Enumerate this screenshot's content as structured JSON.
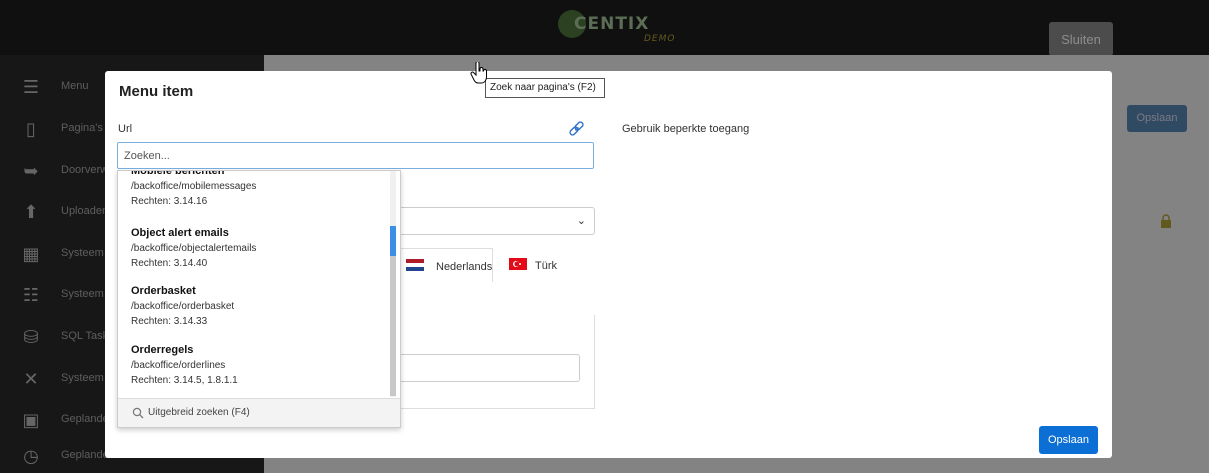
{
  "app": {
    "logo_text": "CENTIX",
    "logo_sub": "DEMO",
    "close_label": "Sluiten"
  },
  "sidebar": {
    "items": [
      {
        "icon": "menu-icon",
        "label": "Menu"
      },
      {
        "icon": "page-icon",
        "label": "Pagina's"
      },
      {
        "icon": "redirect-icon",
        "label": "Doorverw"
      },
      {
        "icon": "upload-icon",
        "label": "Uploaden"
      },
      {
        "icon": "table-icon",
        "label": "Systeem"
      },
      {
        "icon": "sliders-icon",
        "label": "Systeem"
      },
      {
        "icon": "database-icon",
        "label": "SQL Task"
      },
      {
        "icon": "tools-icon",
        "label": "Systeem"
      },
      {
        "icon": "calendar-icon",
        "label": "Geplande"
      },
      {
        "icon": "timer-icon",
        "label": "Geplande"
      }
    ]
  },
  "background": {
    "save_label": "Opslaan"
  },
  "modal": {
    "title": "Menu item",
    "url_label": "Url",
    "restricted_label": "Gebruik beperkte toegang",
    "search_placeholder": "Zoeken...",
    "tooltip": "Zoek naar pagina's (F2)",
    "save_label": "Opslaan",
    "tabs": [
      {
        "label": "Nederlands",
        "flag": "nl"
      },
      {
        "label": "Türk",
        "flag": "tr"
      }
    ]
  },
  "dropdown": {
    "items": [
      {
        "title": "Mobiele berichten",
        "path": "/backoffice/mobilemessages",
        "rights": "Rechten: 3.14.16"
      },
      {
        "title": "Object alert emails",
        "path": "/backoffice/objectalertemails",
        "rights": "Rechten: 3.14.40"
      },
      {
        "title": "Orderbasket",
        "path": "/backoffice/orderbasket",
        "rights": "Rechten: 3.14.33"
      },
      {
        "title": "Orderregels",
        "path": "/backoffice/orderlines",
        "rights": "Rechten: 3.14.5, 1.8.1.1"
      }
    ],
    "footer_label": "Uitgebreid zoeken (F4)"
  },
  "colors": {
    "primary": "#0b6fd6",
    "focus_border": "#7ab0e0",
    "overlay": "rgba(0,0,0,0.45)"
  }
}
